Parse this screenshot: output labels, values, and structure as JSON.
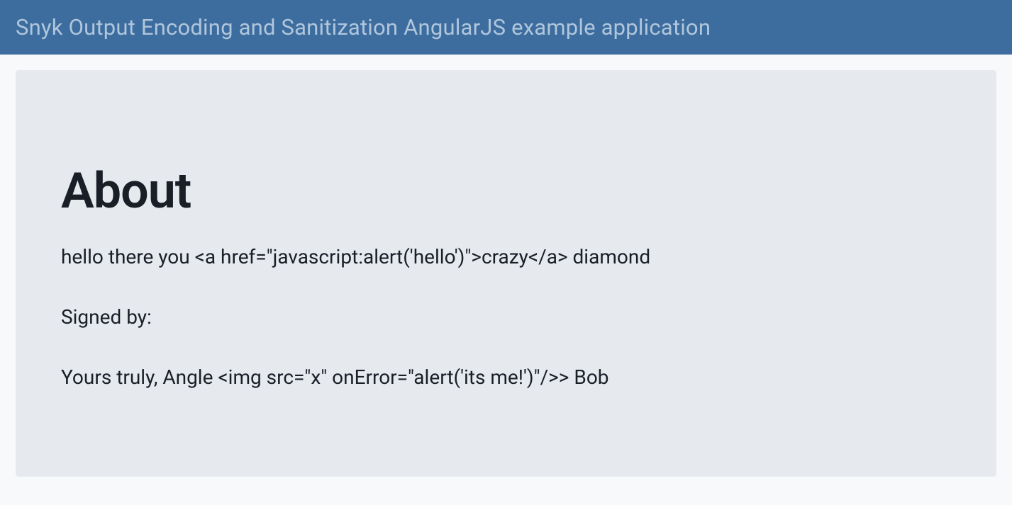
{
  "navbar": {
    "brand": "Snyk Output Encoding and Sanitization AngularJS example application"
  },
  "page": {
    "title": "About",
    "paragraph1": "hello there you <a href=\"javascript:alert('hello')\">crazy</a> diamond",
    "paragraph2": "Signed by:",
    "paragraph3": "Yours truly, Angle <img src=\"x\" onError=\"alert('its me!')\"/>> Bob"
  }
}
